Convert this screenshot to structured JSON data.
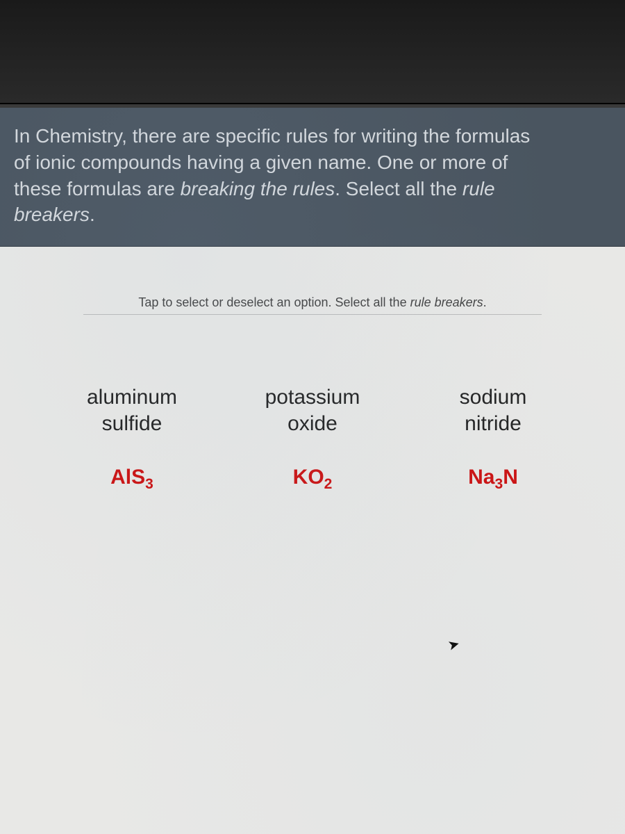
{
  "question": {
    "line1": "In Chemistry, there are specific rules for writing the formulas",
    "line2": "of ionic compounds having a given name. One or more of",
    "line3a": "these formulas are ",
    "line3b_italic": "breaking the rules",
    "line3c": ". Select all the ",
    "line3d_italic": "rule",
    "line4_italic": "breakers",
    "line4_end": "."
  },
  "instruction": {
    "prefix": "Tap to select or deselect an option. Select all the ",
    "italic": "rule breakers",
    "suffix": "."
  },
  "options": [
    {
      "name_line1": "aluminum",
      "name_line2": "sulfide",
      "formula_parts": [
        {
          "t": "AlS",
          "sub": false
        },
        {
          "t": "3",
          "sub": true
        }
      ]
    },
    {
      "name_line1": "potassium",
      "name_line2": "oxide",
      "formula_parts": [
        {
          "t": "KO",
          "sub": false
        },
        {
          "t": "2",
          "sub": true
        }
      ]
    },
    {
      "name_line1": "sodium",
      "name_line2": "nitride",
      "formula_parts": [
        {
          "t": "Na",
          "sub": false
        },
        {
          "t": "3",
          "sub": true
        },
        {
          "t": "N",
          "sub": false
        }
      ]
    }
  ],
  "colors": {
    "header_bg": "#4a5560",
    "screen_bg": "#e8e8e6",
    "formula_color": "#c11"
  }
}
